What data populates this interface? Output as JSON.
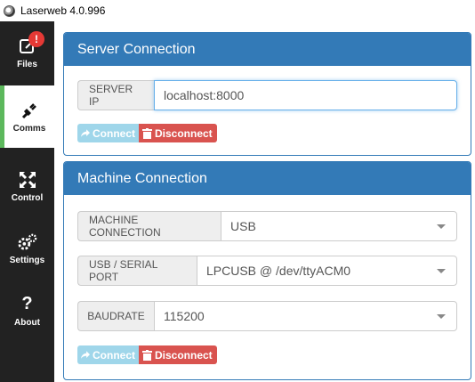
{
  "window": {
    "title": "Laserweb 4.0.996"
  },
  "sidebar": {
    "items": [
      {
        "label": "Files",
        "icon": "file-edit-icon",
        "badge": "!"
      },
      {
        "label": "Comms",
        "icon": "plug-icon"
      },
      {
        "label": "Control",
        "icon": "arrows-expand-icon"
      },
      {
        "label": "Settings",
        "icon": "gears-icon"
      },
      {
        "label": "About",
        "icon": "question-icon"
      }
    ],
    "active": "Comms",
    "accent": "#5cb85c"
  },
  "server": {
    "title": "Server Connection",
    "ip_label": "SERVER IP",
    "ip_value": "localhost:8000",
    "connect_label": "Connect",
    "disconnect_label": "Disconnect"
  },
  "machine": {
    "title": "Machine Connection",
    "connection_label": "MACHINE CONNECTION",
    "connection_value": "USB",
    "port_label": "USB / SERIAL PORT",
    "port_value": "LPCUSB @ /dev/ttyACM0",
    "baud_label": "BAUDRATE",
    "baud_value": "115200",
    "connect_label": "Connect",
    "disconnect_label": "Disconnect"
  },
  "colors": {
    "primary": "#337ab7",
    "danger": "#d9534f",
    "info_disabled": "#9fd6ea"
  }
}
